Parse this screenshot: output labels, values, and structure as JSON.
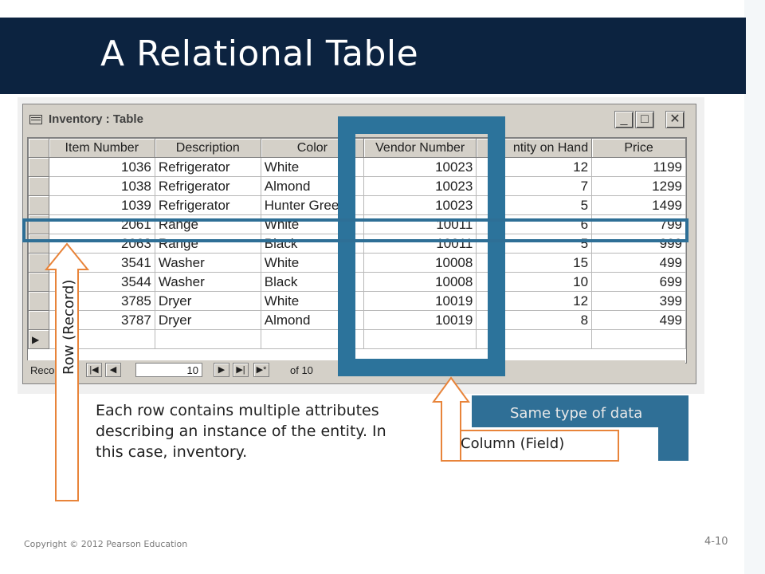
{
  "slide": {
    "title": "A Relational Table",
    "footer_left": "Copyright © 2012 Pearson Education",
    "footer_right": "4-10"
  },
  "window": {
    "title": "Inventory : Table",
    "buttons": {
      "minimize": "_",
      "maximize": "□",
      "close": "✕"
    }
  },
  "table": {
    "columns": [
      "Item Number",
      "Description",
      "Color",
      "Vendor Number",
      "Quantity on Hand",
      "Price"
    ],
    "column_headers_visible": [
      "Item Number",
      "Description",
      "Color",
      "Vendor Number",
      "C",
      "ntity on Hand",
      "Price"
    ],
    "rows": [
      [
        "1036",
        "Refrigerator",
        "White",
        "10023",
        "12",
        "1199"
      ],
      [
        "1038",
        "Refrigerator",
        "Almond",
        "10023",
        "7",
        "1299"
      ],
      [
        "1039",
        "Refrigerator",
        "Hunter Gree",
        "10023",
        "5",
        "1499"
      ],
      [
        "2061",
        "Range",
        "White",
        "10011",
        "6",
        "799"
      ],
      [
        "2063",
        "Range",
        "Black",
        "10011",
        "5",
        "999"
      ],
      [
        "3541",
        "Washer",
        "White",
        "10008",
        "15",
        "499"
      ],
      [
        "3544",
        "Washer",
        "Black",
        "10008",
        "10",
        "699"
      ],
      [
        "3785",
        "Dryer",
        "White",
        "10019",
        "12",
        "399"
      ],
      [
        "3787",
        "Dryer",
        "Almond",
        "10019",
        "8",
        "499"
      ]
    ],
    "new_row_marker": "▶"
  },
  "navigation": {
    "label": "Reco",
    "current_record": "10",
    "of_label": "of 10",
    "first": "|◀",
    "prev": "◀",
    "next": "▶",
    "last": "▶|",
    "new": "▶*"
  },
  "annotations": {
    "row_label": "Row (Record)",
    "column_label": "Column (Field)",
    "same_type": "Same type of data",
    "description": "Each row contains multiple attributes describing an instance of the entity. In this case, inventory."
  },
  "colors": {
    "title_bar": "#0c2340",
    "highlight": "#2c739b",
    "arrow_stroke": "#e8843a"
  }
}
